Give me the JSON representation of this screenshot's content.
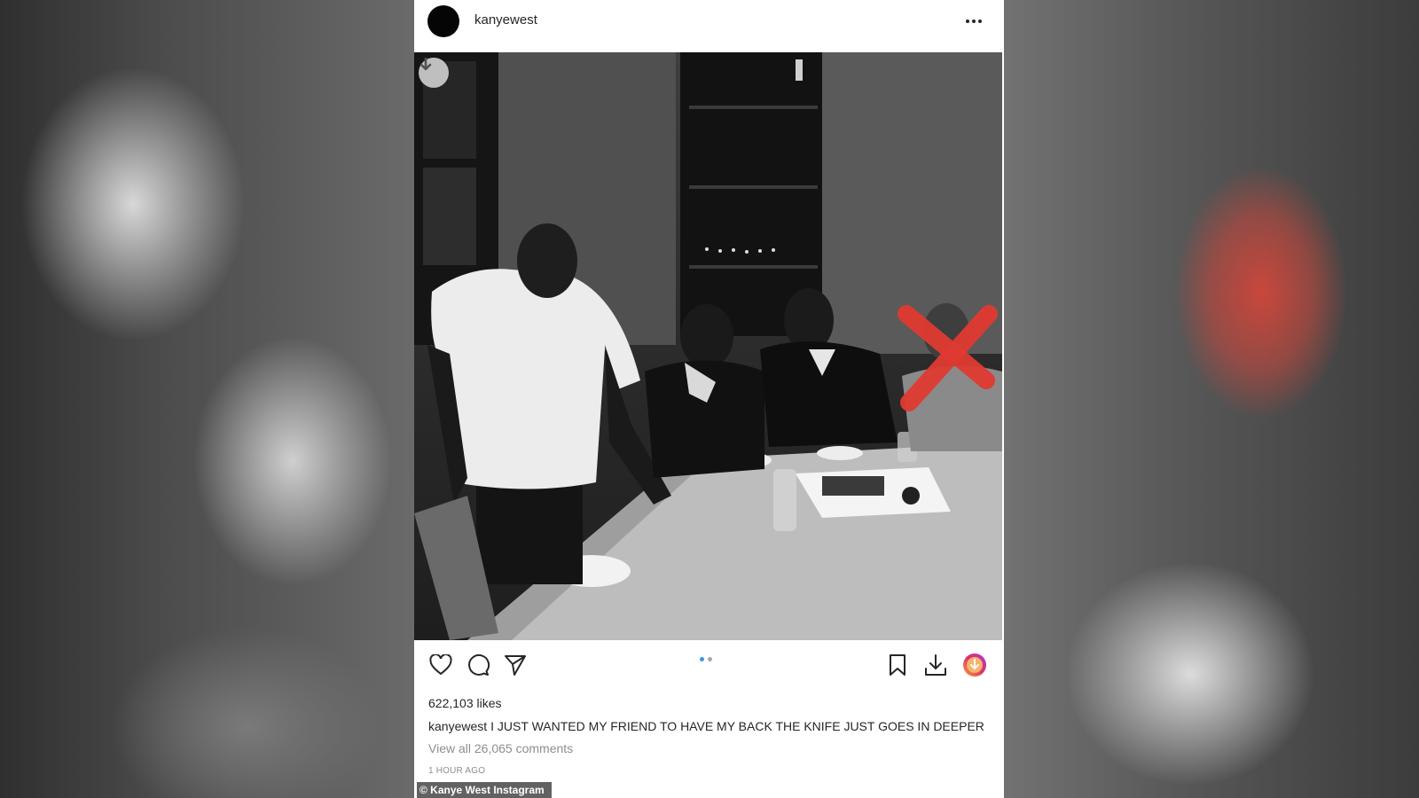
{
  "post": {
    "username": "kanyewest",
    "likes": "622,103 likes",
    "caption_user": "kanyewest",
    "caption_text": "I JUST WANTED MY FRIEND TO HAVE MY BACK THE KNIFE JUST GOES IN DEEPER",
    "view_comments": "View all 26,065 comments",
    "time_ago": "1 HOUR AGO",
    "carousel": {
      "total": 2,
      "active": 1
    }
  },
  "credit": "© Kanye West Instagram",
  "icons": {
    "more": "more-horizontal-icon",
    "download_overlay": "download-arrow-icon",
    "like": "heart-icon",
    "comment": "comment-bubble-icon",
    "share": "paper-plane-icon",
    "save": "bookmark-icon",
    "download": "download-icon",
    "extension": "gradient-circle-icon"
  },
  "colors": {
    "cross_mark": "#e03a31",
    "carousel_active": "#3897f0",
    "carousel_inactive": "#a8a8a8"
  }
}
